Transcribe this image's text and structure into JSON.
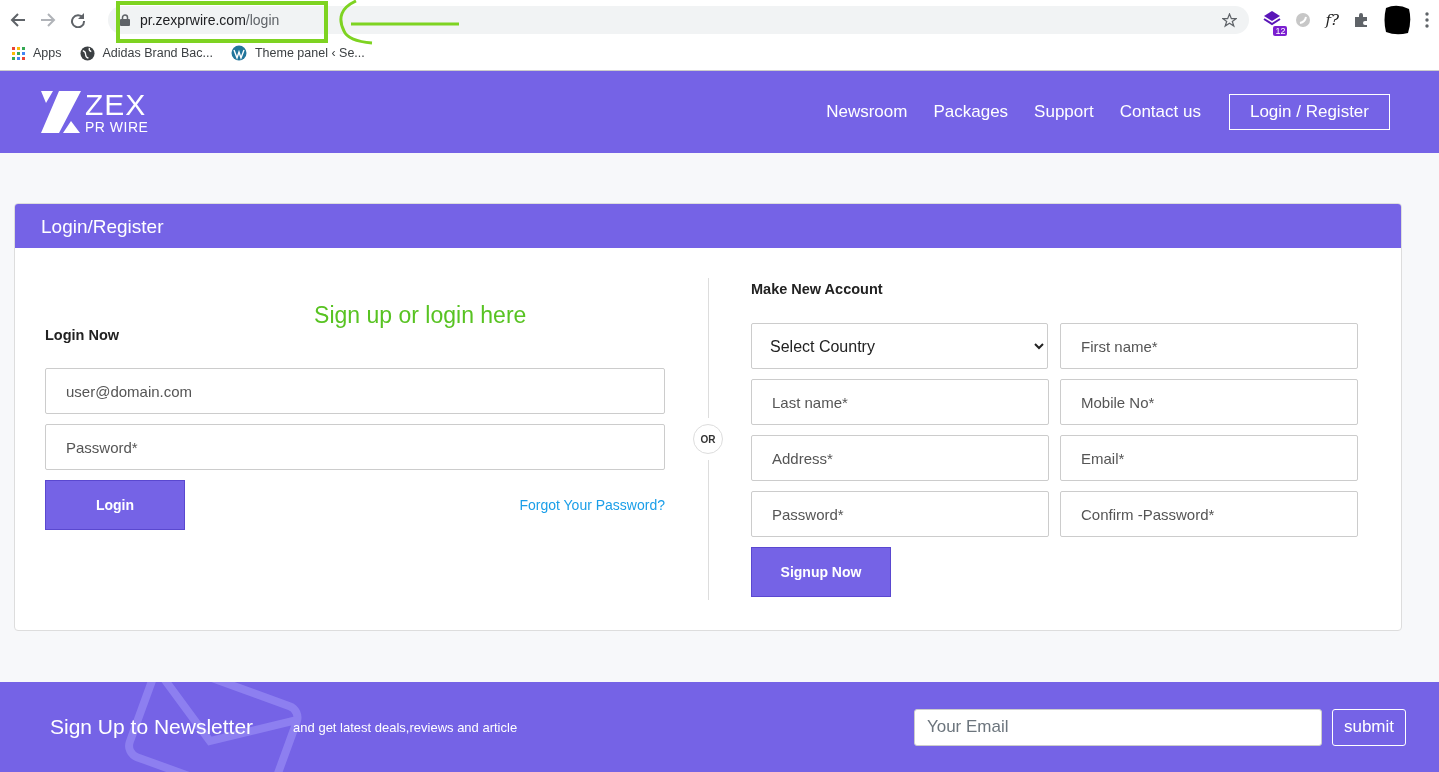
{
  "browser": {
    "url_host": "pr.zexprwire.com",
    "url_path": "/login",
    "extension_badge": "12",
    "extension_text": "f?",
    "bookmarks": [
      {
        "label": "Apps",
        "kind": "apps"
      },
      {
        "label": "Adidas Brand Bac...",
        "kind": "globe"
      },
      {
        "label": "Theme panel ‹ Se...",
        "kind": "wordpress"
      }
    ]
  },
  "header": {
    "logo": {
      "title": "ZEX",
      "subtitle": "PR WIRE"
    },
    "nav": [
      "Newsroom",
      "Packages",
      "Support",
      "Contact us"
    ],
    "nav_button": "Login / Register"
  },
  "panel": {
    "title": "Login/Register",
    "annotation": "Sign up or login here",
    "login": {
      "heading": "Login Now",
      "fields": [
        {
          "placeholder": "user@domain.com"
        },
        {
          "placeholder": "Password*"
        }
      ],
      "button": "Login",
      "forgot_link": "Forgot Your Password?"
    },
    "divider": "OR",
    "register": {
      "heading": "Make New Account",
      "country_select": "Select Country",
      "fields": [
        {
          "placeholder": "First name*"
        },
        {
          "placeholder": "Last name*"
        },
        {
          "placeholder": "Mobile No*"
        },
        {
          "placeholder": "Address*"
        },
        {
          "placeholder": "Email*"
        },
        {
          "placeholder": "Password*"
        },
        {
          "placeholder": "Confirm -Password*"
        }
      ],
      "button": "Signup Now"
    }
  },
  "footer": {
    "title": "Sign Up to Newsletter",
    "subtitle": "and get latest deals,reviews and article",
    "email_placeholder": "Your Email",
    "button": "submit"
  }
}
